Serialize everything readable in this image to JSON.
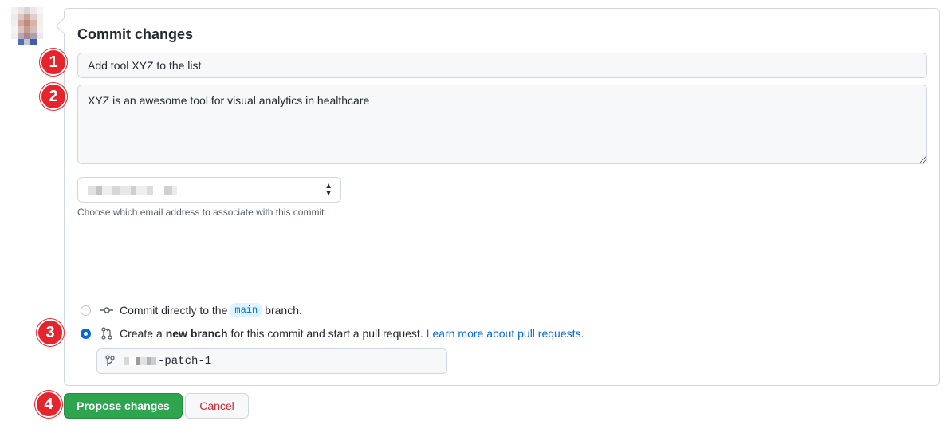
{
  "form": {
    "title": "Commit changes",
    "summary_value": "Add tool XYZ to the list",
    "description_value": "XYZ is an awesome tool for visual analytics in healthcare",
    "email_note": "Choose which email address to associate with this commit"
  },
  "options": {
    "direct": {
      "text_before": "Commit directly to the",
      "branch_name": "main",
      "text_after": "branch.",
      "selected": false
    },
    "new_branch": {
      "text_before": "Create a",
      "bold": "new branch",
      "text_after": "for this commit and start a pull request.",
      "link": "Learn more about pull requests.",
      "selected": true
    }
  },
  "branch_input": {
    "suffix": "-patch-1"
  },
  "buttons": {
    "propose": "Propose changes",
    "cancel": "Cancel"
  },
  "badges": [
    "1",
    "2",
    "3",
    "4"
  ],
  "icons": {
    "commit": "git-commit-icon",
    "pull_request": "git-pull-request-icon",
    "branch": "git-branch-icon",
    "select": "select-arrows-icon"
  },
  "colors": {
    "primary_button": "#2da44e",
    "link": "#0969da",
    "danger": "#cf222e",
    "badge": "#e5242b"
  }
}
